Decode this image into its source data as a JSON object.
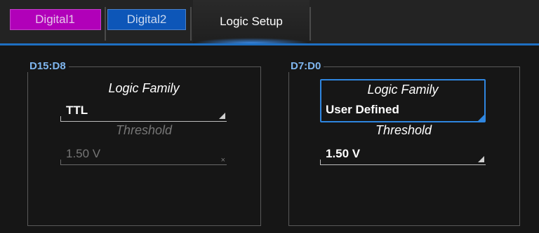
{
  "tabs": [
    {
      "label": "Digital1",
      "color": "#b100b9"
    },
    {
      "label": "Digital2",
      "color": "#0d56b8"
    },
    {
      "label": "Logic Setup",
      "active": true
    }
  ],
  "groups": {
    "left": {
      "title": "D15:D8",
      "logic_family_label": "Logic Family",
      "logic_family_value": "TTL",
      "threshold_label": "Threshold",
      "threshold_value": "1.50 V",
      "threshold_enabled": false
    },
    "right": {
      "title": "D7:D0",
      "logic_family_label": "Logic Family",
      "logic_family_value": "User Defined",
      "threshold_label": "Threshold",
      "threshold_value": "1.50 V",
      "threshold_enabled": true
    }
  },
  "colors": {
    "accent": "#1e6fc2",
    "group_title": "#7fb6ef"
  }
}
